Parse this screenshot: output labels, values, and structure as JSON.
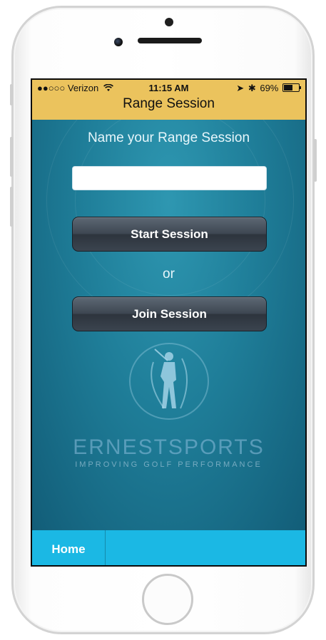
{
  "status_bar": {
    "carrier": "●●○○○ Verizon",
    "wifi_icon": "wifi-icon",
    "time": "11:15 AM",
    "battery_percent": "69%",
    "battery_level": 0.69
  },
  "nav": {
    "title": "Range Session"
  },
  "form": {
    "label": "Name your Range Session",
    "input_value": "",
    "input_placeholder": "",
    "start_button": "Start Session",
    "or_text": "or",
    "join_button": "Join Session"
  },
  "brand": {
    "name": "ERNESTSPORTS",
    "tagline": "IMPROVING GOLF PERFORMANCE",
    "logo_icon": "golfer-icon"
  },
  "tabbar": {
    "home_label": "Home"
  },
  "colors": {
    "nav_bg": "#ebc35d",
    "content_bg": "#1f7e99",
    "tabbar_bg": "#1bb8e4",
    "button_dark": "#3e4752"
  }
}
